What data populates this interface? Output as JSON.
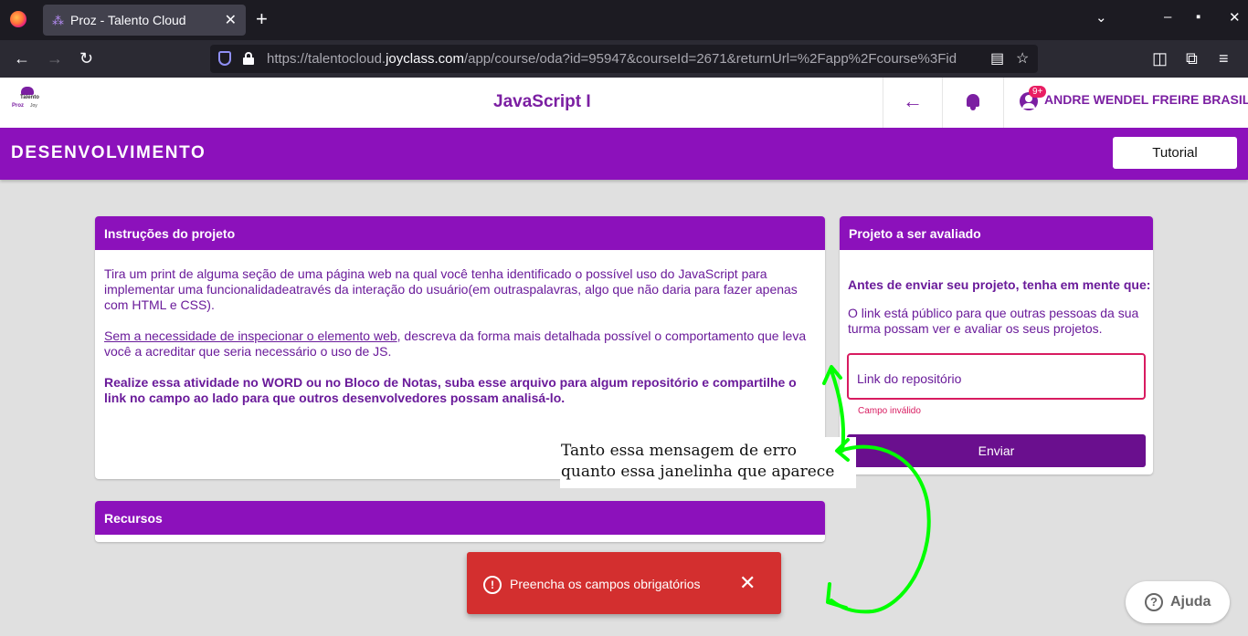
{
  "browser": {
    "tab_title": "Proz - Talento Cloud",
    "tab_favicon": "⁂",
    "url_prefix": "https://talentocloud.",
    "url_domain": "joyclass.com",
    "url_path": "/app/course/oda?id=95947&courseId=2671&returnUrl=%2Fapp%2Fcourse%3Fid"
  },
  "header": {
    "logo_top": "Talento",
    "logo_left": "Proz",
    "logo_right": "Joy",
    "course_title": "JavaScript I",
    "notifications_badge": "9+",
    "user_name": "ANDRE WENDEL FREIRE BRASIL"
  },
  "banner": {
    "section_title": "DESENVOLVIMENTO",
    "tutorial_label": "Tutorial"
  },
  "instructions": {
    "title": "Instruções do projeto",
    "p1": "Tira um print de alguma seção de uma página web na qual você tenha identificado o possível uso do JavaScript para implementar uma funcionalidadeatravés da interação do usuário(em outraspalavras, algo que não daria para fazer apenas com HTML e CSS).",
    "p2_link": "Sem a necessidade de inspecionar o elemento web",
    "p2_rest": ", descreva da forma mais detalhada possível o comportamento que leva você a acreditar que seria necessário o uso de JS.",
    "p3": "Realize essa atividade no WORD ou no Bloco de Notas, suba esse arquivo para algum repositório e compartilhe o link no campo ao lado para que outros desenvolvedores possam analisá-lo."
  },
  "project": {
    "title": "Projeto a ser avaliado",
    "lead": "Antes de enviar seu projeto, tenha em mente que:",
    "info": "O link está público para que outras pessoas da sua turma possam ver e avaliar os seus projetos.",
    "input_label": "Link do repositório",
    "error": "Campo inválido",
    "submit_label": "Enviar"
  },
  "resources": {
    "title": "Recursos"
  },
  "annotation": {
    "line1": "Tanto essa mensagem de erro",
    "line2": "quanto essa janelinha que aparece",
    "arrow_color": "#00ff00"
  },
  "toast": {
    "message": "Preencha os campos obrigatórios",
    "color": "#d32f2f"
  },
  "help": {
    "label": "Ajuda"
  },
  "colors": {
    "brand_purple": "#8c11bb",
    "text_purple": "#6a1b9a",
    "error_pink": "#d81b60"
  },
  "icons": [
    "firefox-icon",
    "close-icon",
    "plus-icon",
    "chevron-down-icon",
    "minimize-icon",
    "maximize-icon",
    "back-icon",
    "forward-icon",
    "reload-icon",
    "shield-icon",
    "lock-icon",
    "reader-icon",
    "star-icon",
    "pocket-icon",
    "extensions-icon",
    "menu-icon",
    "arrow-left-icon",
    "bell-icon",
    "account-icon",
    "alert-circle-icon",
    "help-circle-icon"
  ]
}
